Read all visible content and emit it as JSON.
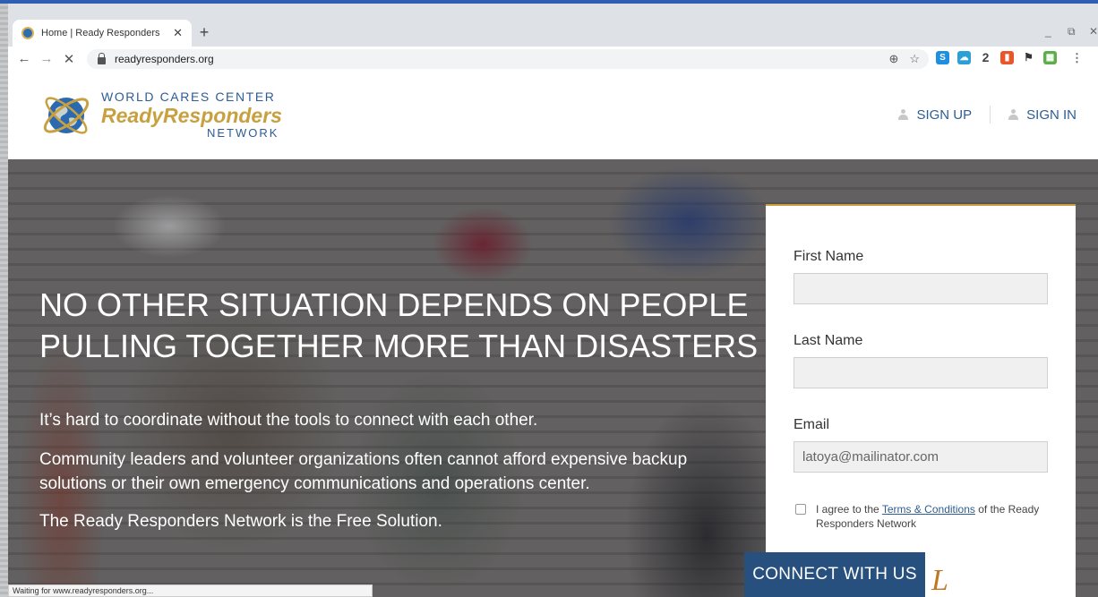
{
  "browser": {
    "tab_title": "Home | Ready Responders",
    "tab_close": "✕",
    "new_tab": "+",
    "window_minimize": "_",
    "window_restore": "⧉",
    "window_close": "✕",
    "url": "readyresponders.org",
    "status_text": "Waiting for www.readyresponders.org...",
    "extension_badge": "2"
  },
  "header": {
    "logo_line1": "WORLD CARES CENTER",
    "logo_line2": "ReadyResponders",
    "logo_line3": "NETWORK",
    "sign_up": "SIGN UP",
    "sign_in": "SIGN IN"
  },
  "hero": {
    "headline_line1": "NO OTHER SITUATION DEPENDS ON PEOPLE",
    "headline_line2": "PULLING TOGETHER MORE THAN DISASTERS",
    "paragraph1": "It’s hard to coordinate without the tools to connect with each other.",
    "paragraph2": "Community leaders and volunteer organizations often cannot afford expensive backup solutions or their own emergency communications and operations center.",
    "paragraph3": "The Ready Responders Network is the Free Solution."
  },
  "form": {
    "first_name_label": "First Name",
    "first_name_value": "",
    "last_name_label": "Last Name",
    "last_name_value": "",
    "email_label": "Email",
    "email_value": "latoya@mailinator.com",
    "agree_prefix": "I agree to the ",
    "agree_link": "Terms & Conditions",
    "agree_suffix": " of the Ready Responders Network",
    "agree_checked": false
  },
  "cta": {
    "connect_label": "CONNECT WITH US"
  },
  "colors": {
    "brand_blue": "#2d5d93",
    "brand_gold": "#c8a040",
    "button_blue": "#27507f",
    "chrome_accent": "#2f5fb3"
  }
}
